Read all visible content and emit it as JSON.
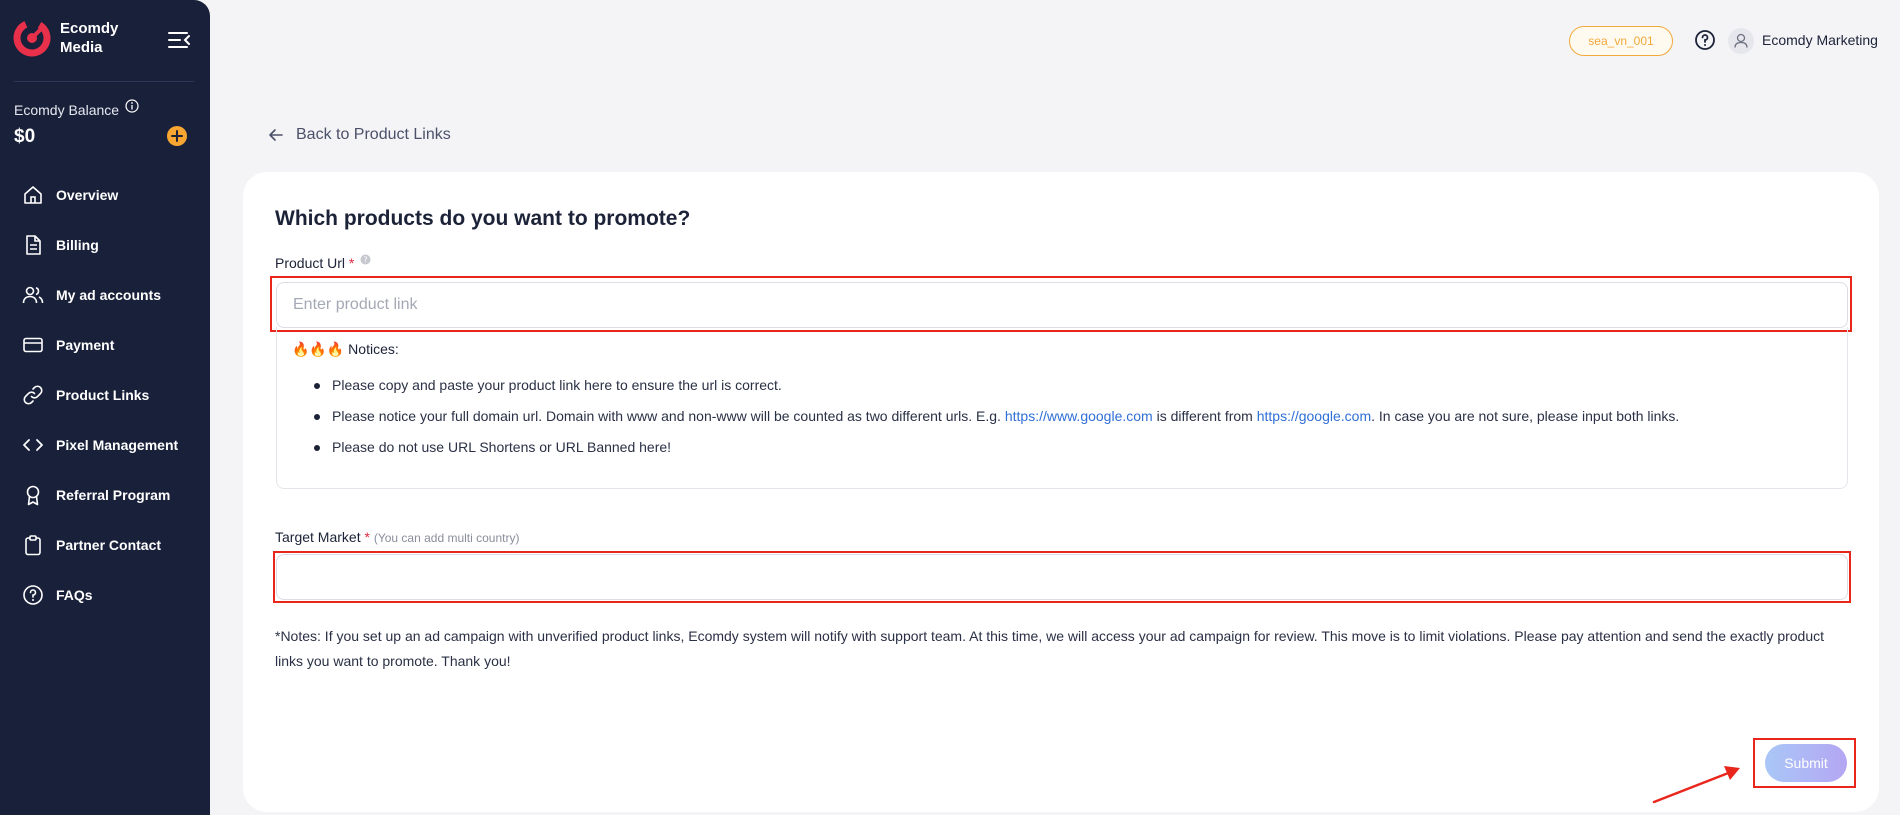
{
  "brand": {
    "name": "Ecomdy Media"
  },
  "balance": {
    "label": "Ecomdy Balance",
    "value": "$0"
  },
  "nav": {
    "items": [
      {
        "label": "Overview",
        "icon": "home-icon"
      },
      {
        "label": "Billing",
        "icon": "document-icon"
      },
      {
        "label": "My ad accounts",
        "icon": "users-icon"
      },
      {
        "label": "Payment",
        "icon": "credit-card-icon"
      },
      {
        "label": "Product Links",
        "icon": "link-icon"
      },
      {
        "label": "Pixel Management",
        "icon": "code-icon"
      },
      {
        "label": "Referral Program",
        "icon": "award-icon"
      },
      {
        "label": "Partner Contact",
        "icon": "clipboard-icon"
      },
      {
        "label": "FAQs",
        "icon": "help-circle-icon"
      }
    ]
  },
  "header": {
    "account_id": "sea_vn_001",
    "user_name": "Ecomdy Marketing"
  },
  "back": {
    "label": "Back to Product Links"
  },
  "form": {
    "title": "Which products do you want to promote?",
    "product_url": {
      "label": "Product Url",
      "required": "*",
      "placeholder": "Enter product link",
      "value": ""
    },
    "notices": {
      "title": "🔥🔥🔥 Notices:",
      "item1": "Please copy and paste your product link here to ensure the url is correct.",
      "item2_before": "Please notice your full domain url. Domain with www and non-www will be counted as two different urls. E.g. ",
      "item2_link1": "https://www.google.com",
      "item2_middle": " is different from ",
      "item2_link2": "https://google.com",
      "item2_after": ". In case you are not sure, please input both links.",
      "item3": "Please do not use URL Shortens or URL Banned here!"
    },
    "target_market": {
      "label": "Target Market",
      "required": "*",
      "hint": "(You can add multi country)"
    },
    "footnote": "*Notes: If you set up an ad campaign with unverified product links, Ecomdy system will notify with support team. At this time, we will access your ad campaign for review. This move is to limit violations. Please pay attention and send the exactly product links you want to promote. Thank you!",
    "submit_label": "Submit"
  },
  "colors": {
    "sidebar": "#19203a",
    "accent": "#e0283f",
    "highlight": "#e8261c",
    "link": "#2f6fd6"
  }
}
